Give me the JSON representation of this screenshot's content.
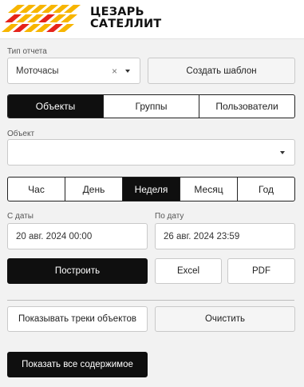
{
  "brand": {
    "line1": "ЦЕЗАРЬ",
    "line2": "САТЕЛЛИТ",
    "stripe_color": "#f7b500",
    "accent_color": "#e5231b"
  },
  "report_type": {
    "label": "Тип отчета",
    "value": "Моточасы",
    "clear_symbol": "×"
  },
  "create_template_label": "Создать шаблон",
  "entity_tabs": [
    {
      "label": "Объекты",
      "active": true
    },
    {
      "label": "Группы",
      "active": false
    },
    {
      "label": "Пользователи",
      "active": false
    }
  ],
  "object": {
    "label": "Объект",
    "value": ""
  },
  "period_tabs": [
    {
      "label": "Час",
      "active": false
    },
    {
      "label": "День",
      "active": false
    },
    {
      "label": "Неделя",
      "active": true
    },
    {
      "label": "Месяц",
      "active": false
    },
    {
      "label": "Год",
      "active": false
    }
  ],
  "date_from": {
    "label": "С даты",
    "value": "20 авг. 2024 00:00"
  },
  "date_to": {
    "label": "По дату",
    "value": "26 авг. 2024 23:59"
  },
  "actions": {
    "build": "Построить",
    "excel": "Excel",
    "pdf": "PDF"
  },
  "show_tracks_label": "Показывать треки объектов",
  "clear_label": "Очистить",
  "show_all_label": "Показать все содержимое"
}
